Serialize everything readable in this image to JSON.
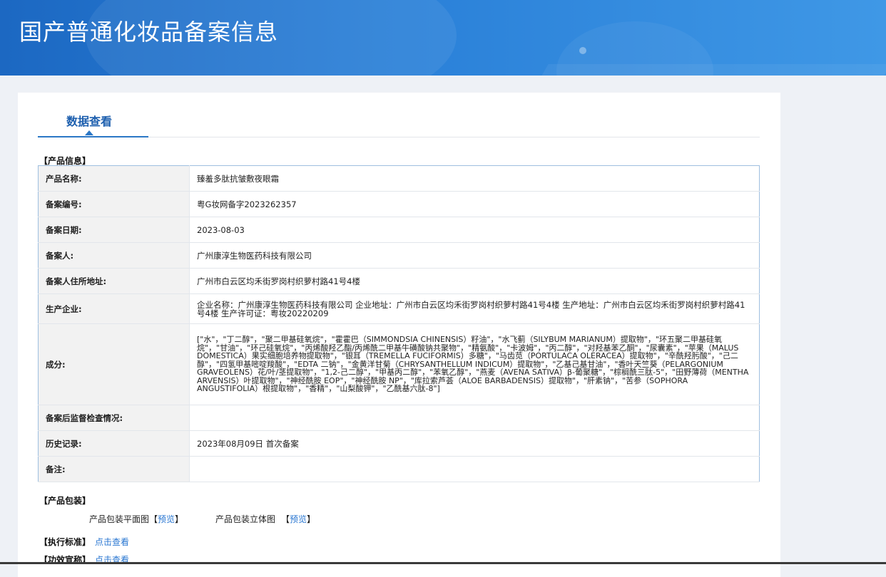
{
  "header": {
    "title": "国产普通化妆品备案信息"
  },
  "tabs": [
    {
      "label": "数据查看",
      "active": true
    }
  ],
  "product_info": {
    "section_title": "【产品信息】",
    "rows": [
      {
        "label": "产品名称:",
        "value": "臻羞多肽抗皱敷夜眼霜"
      },
      {
        "label": "备案编号:",
        "value": "粤G妆网备字2023262357"
      },
      {
        "label": "备案日期:",
        "value": "2023-08-03"
      },
      {
        "label": "备案人:",
        "value": "广州康淳生物医药科技有限公司"
      },
      {
        "label": "备案人住所地址:",
        "value": "广州市白云区均禾街罗岗村织萝村路41号4楼"
      },
      {
        "label": "生产企业:",
        "value": "企业名称：广州康淳生物医药科技有限公司 企业地址：广州市白云区均禾街罗岗村织萝村路41号4楼 生产地址：广州市白云区均禾街罗岗村织萝村路41号4楼 生产许可证：粤妆20220209"
      },
      {
        "label": "成分:",
        "value": "[\"水\"，\"丁二醇\"，\"聚二甲基硅氧烷\"，\"霍霍巴（SIMMONDSIA CHINENSIS）籽油\"，\"水飞蓟（SILYBUM MARIANUM）提取物\"，\"环五聚二甲基硅氧烷\"，\"甘油\"，\"环己硅氧烷\"，\"丙烯酸羟乙酯/丙烯酰二甲基牛磺酸钠共聚物\"，\"精氨酸\"，\"卡波姆\"，\"丙二醇\"，\"对羟基苯乙酮\"，\"尿囊素\"，\"苹果（MALUS DOMESTICA）果实细胞培养物提取物\"，\"银耳（TREMELLA FUCIFORMIS）多糖\"，\"马齿苋（PORTULACA OLERACEA）提取物\"，\"辛酰羟肟酸\"，\"己二醇\"，\"四氢甲基嘧啶羧酸\"，\"EDTA 二钠\"，\"金黄洋甘菊（CHRYSANTHELLUM INDICUM）提取物\"，\"乙基己基甘油\"，\"香叶天竺葵（PELARGONIUM GRAVEOLENS）花/叶/茎提取物\"，\"1,2-己二醇\"，\"甲基丙二醇\"，\"苯氧乙醇\"，\"燕麦（AVENA SATIVA）β-葡聚糖\"，\"棕榈酰三肽-5\"，\"田野薄荷（MENTHA ARVENSIS）叶提取物\"，\"神经酰胺 EOP\"，\"神经酰胺 NP\"，\"库拉索芦荟（ALOE BARBADENSIS）提取物\"，\"肝素钠\"，\"苦参（SOPHORA ANGUSTIFOLIA）根提取物\"，\"香精\"，\"山梨酸钾\"，\"乙酰基六肽-8\"]"
      },
      {
        "label": "备案后监督检查情况:",
        "value": ""
      },
      {
        "label": "历史记录:",
        "value": "2023年08月09日 首次备案"
      },
      {
        "label": "备注:",
        "value": ""
      }
    ]
  },
  "packaging": {
    "section_title": "【产品包装】",
    "flat_label": "产品包装平面图",
    "stereo_label": "产品包装立体图",
    "bracket_open": "【",
    "bracket_close": "】",
    "preview_link": "预览"
  },
  "standard": {
    "label": "【执行标准】",
    "link": "点击查看"
  },
  "efficacy": {
    "label": "【功效宣称】",
    "link": "点击查看"
  },
  "colors": {
    "banner": "#2a80d8",
    "tab_accent": "#2b77c6",
    "link": "#2a77d2",
    "label_bg": "#f2f2f2"
  }
}
